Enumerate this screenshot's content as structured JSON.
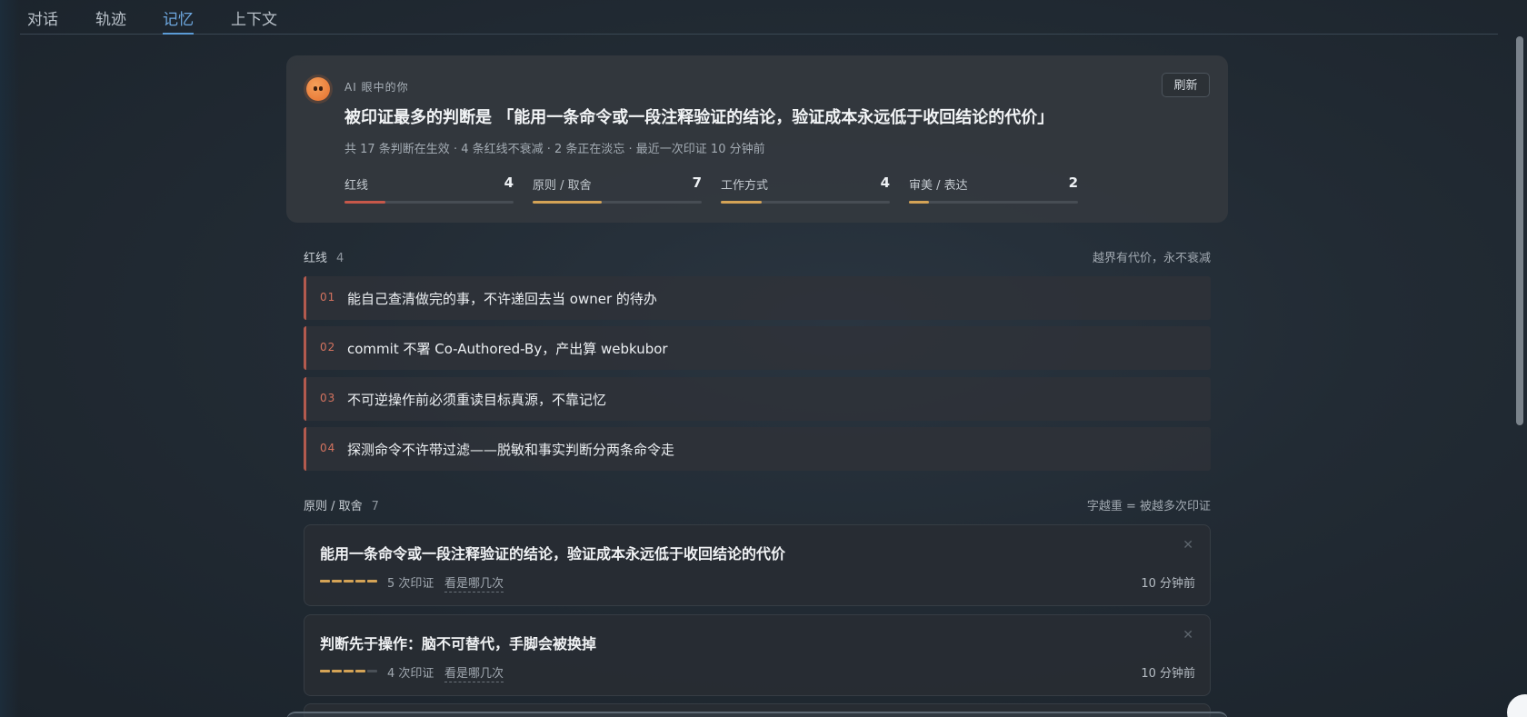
{
  "tabs": [
    {
      "label": "对话"
    },
    {
      "label": "轨迹"
    },
    {
      "label": "记忆",
      "active": true
    },
    {
      "label": "上下文"
    }
  ],
  "summary": {
    "eyebrow": "AI 眼中的你",
    "refresh_label": "刷新",
    "headline": "被印证最多的判断是 「能用一条命令或一段注释验证的结论，验证成本永远低于收回结论的代价」",
    "subline": "共 17 条判断在生效 · 4 条红线不衰减 · 2 条正在淡忘 · 最近一次印证 10 分钟前",
    "stats": [
      {
        "label": "红线",
        "count": "4",
        "fill": 0.24,
        "color": "#c7584a"
      },
      {
        "label": "原则 / 取舍",
        "count": "7",
        "fill": 0.41,
        "color": "#d4a356"
      },
      {
        "label": "工作方式",
        "count": "4",
        "fill": 0.24,
        "color": "#d4a356"
      },
      {
        "label": "审美 / 表达",
        "count": "2",
        "fill": 0.12,
        "color": "#d4a356"
      }
    ]
  },
  "redlines_section": {
    "title": "红线",
    "count": "4",
    "note": "越界有代价，永不衰减",
    "items": [
      {
        "index": "01",
        "text": "能自己查清做完的事，不许递回去当 owner 的待办"
      },
      {
        "index": "02",
        "text": "commit 不署 Co-Authored-By，产出算 webkubor"
      },
      {
        "index": "03",
        "text": "不可逆操作前必须重读目标真源，不靠记忆"
      },
      {
        "index": "04",
        "text": "探测命令不许带过滤——脱敏和事实判断分两条命令走"
      }
    ]
  },
  "principles_section": {
    "title": "原则 / 取舍",
    "count": "7",
    "note": "字越重 = 被越多次印证",
    "items": [
      {
        "title": "能用一条命令或一段注释验证的结论，验证成本永远低于收回结论的代价",
        "confirmations": 5,
        "count_text": "5 次印证",
        "see_label": "看是哪几次",
        "time": "10 分钟前"
      },
      {
        "title": "判断先于操作：脑不可替代，手脚会被换掉",
        "confirmations": 4,
        "count_text": "4 次印证",
        "see_label": "看是哪几次",
        "time": "10 分钟前"
      }
    ]
  },
  "icons": {
    "avatar": "ai-face-icon",
    "close": "close-icon"
  },
  "colors": {
    "accent": "#5b9bd6",
    "redline": "#c7584a",
    "principle": "#d4a356"
  }
}
